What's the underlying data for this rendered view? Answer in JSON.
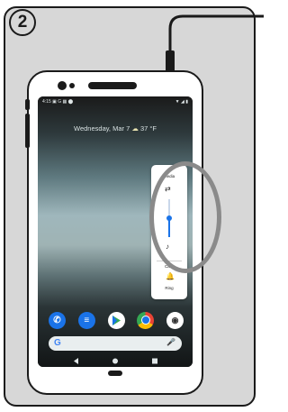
{
  "step": {
    "number": "2"
  },
  "screen": {
    "date": "Wednesday, Mar 7",
    "temperature": "37 °F"
  },
  "volume_panel": {
    "media_label": "Media",
    "calls_label": "Calls",
    "ring_label": "Ring",
    "media_level": 0.55
  },
  "dock": {
    "apps": [
      "phone-icon",
      "messages-icon",
      "play-store-icon",
      "chrome-icon",
      "camera-icon"
    ],
    "search_letter": "G"
  },
  "colors": {
    "accent_blue": "#1a73e8",
    "outline": "#1a1a1a",
    "background_gray": "#d7d7d7",
    "highlight_ring": "#8a8a8a"
  }
}
